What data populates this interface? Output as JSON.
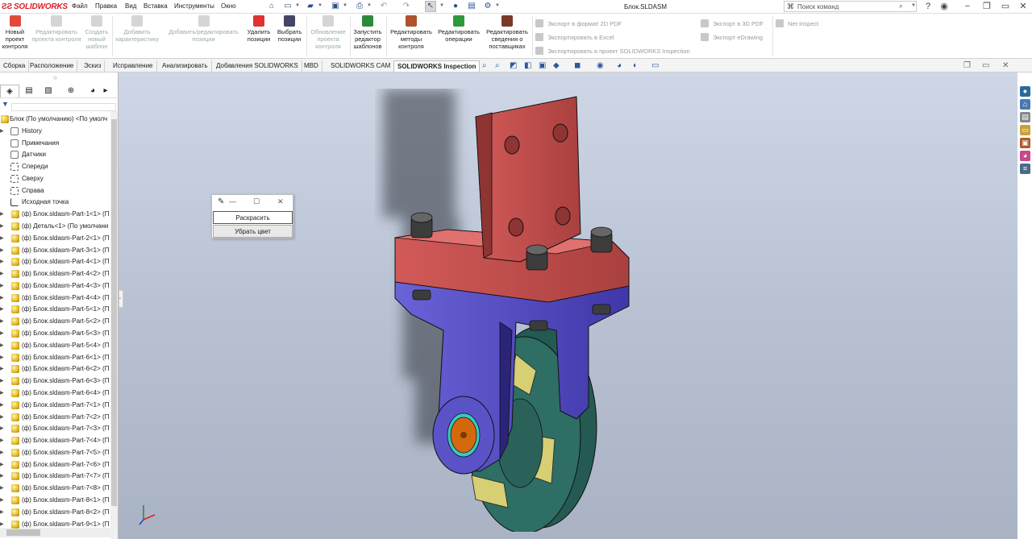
{
  "app": {
    "logo_text": "SOLIDWORKS",
    "brand_color": "#d61f2a"
  },
  "menu": [
    "Файл",
    "Правка",
    "Вид",
    "Вставка",
    "Инструменты",
    "Окно"
  ],
  "document_title": "Блок.SLDASM",
  "search": {
    "placeholder": "Поиск команд"
  },
  "ribbon": {
    "buttons": [
      {
        "label": "Новый проект контроля",
        "enabled": true
      },
      {
        "label": "Редактировать проекта контроля",
        "enabled": false
      },
      {
        "label": "Создать новый шаблон",
        "enabled": false
      },
      {
        "label": "Добавить характеристику",
        "enabled": false
      },
      {
        "label": "Добавить/редактировать позиции",
        "enabled": false
      },
      {
        "label": "Удалить позиции",
        "enabled": true
      },
      {
        "label": "Выбрать позиции",
        "enabled": true
      },
      {
        "label": "Обновление проекта контроля",
        "enabled": false
      },
      {
        "label": "Запустить редактор шаблонов",
        "enabled": true
      },
      {
        "label": "Редактировать методы контроля",
        "enabled": true
      },
      {
        "label": "Редактировать операции",
        "enabled": true
      },
      {
        "label": "Редактировать сведения о поставщиках",
        "enabled": true
      }
    ],
    "export_items": [
      "Экспорт в формат 2D PDF",
      "Экспортировать в Excel",
      "Экспортировать в проект SOLIDWORKS Inspection",
      "Экспорт в 3D PDF",
      "Экспорт eDrawing",
      "Net-Inspect"
    ]
  },
  "tabs": [
    "Сборка",
    "Расположение",
    "Эскиз",
    "Исправление",
    "Анализировать",
    "Добавления SOLIDWORKS",
    "MBD",
    "SOLIDWORKS CAM",
    "SOLIDWORKS Inspection"
  ],
  "active_tab": "SOLIDWORKS Inspection",
  "feature_tree": {
    "root": "Блок (По умолчанию) <По умолч",
    "items": [
      "History",
      "Примечания",
      "Датчики",
      "Спереди",
      "Сверху",
      "Справа",
      "Исходная точка",
      "(ф) Блок.sldasm-Part-1<1> (П",
      "(ф) Деталь<1> (По умолчани",
      "(ф) Блок.sldasm-Part-2<1> (П",
      "(ф) Блок.sldasm-Part-3<1> (П",
      "(ф) Блок.sldasm-Part-4<1> (П",
      "(ф) Блок.sldasm-Part-4<2> (П",
      "(ф) Блок.sldasm-Part-4<3> (П",
      "(ф) Блок.sldasm-Part-4<4> (П",
      "(ф) Блок.sldasm-Part-5<1> (П",
      "(ф) Блок.sldasm-Part-5<2> (П",
      "(ф) Блок.sldasm-Part-5<3> (П",
      "(ф) Блок.sldasm-Part-5<4> (П",
      "(ф) Блок.sldasm-Part-6<1> (П",
      "(ф) Блок.sldasm-Part-6<2> (П",
      "(ф) Блок.sldasm-Part-6<3> (П",
      "(ф) Блок.sldasm-Part-6<4> (П",
      "(ф) Блок.sldasm-Part-7<1> (П",
      "(ф) Блок.sldasm-Part-7<2> (П",
      "(ф) Блок.sldasm-Part-7<3> (П",
      "(ф) Блок.sldasm-Part-7<4> (П",
      "(ф) Блок.sldasm-Part-7<5> (П",
      "(ф) Блок.sldasm-Part-7<6> (П",
      "(ф) Блок.sldasm-Part-7<7> (П",
      "(ф) Блок.sldasm-Part-7<8> (П",
      "(ф) Блок.sldasm-Part-8<1> (П",
      "(ф) Блок.sldasm-Part-8<2> (П",
      "(ф) Блок.sldasm-Part-9<1> (П"
    ]
  },
  "popup": {
    "buttons": [
      "Раскрасить",
      "Убрать цвет"
    ]
  },
  "colors": {
    "bracket_red": "#c8504f",
    "base_blue": "#5a53c8",
    "wheel_teal": "#2e6e64",
    "hub_orange": "#d4680c",
    "insert_yellow": "#d6cf73"
  }
}
